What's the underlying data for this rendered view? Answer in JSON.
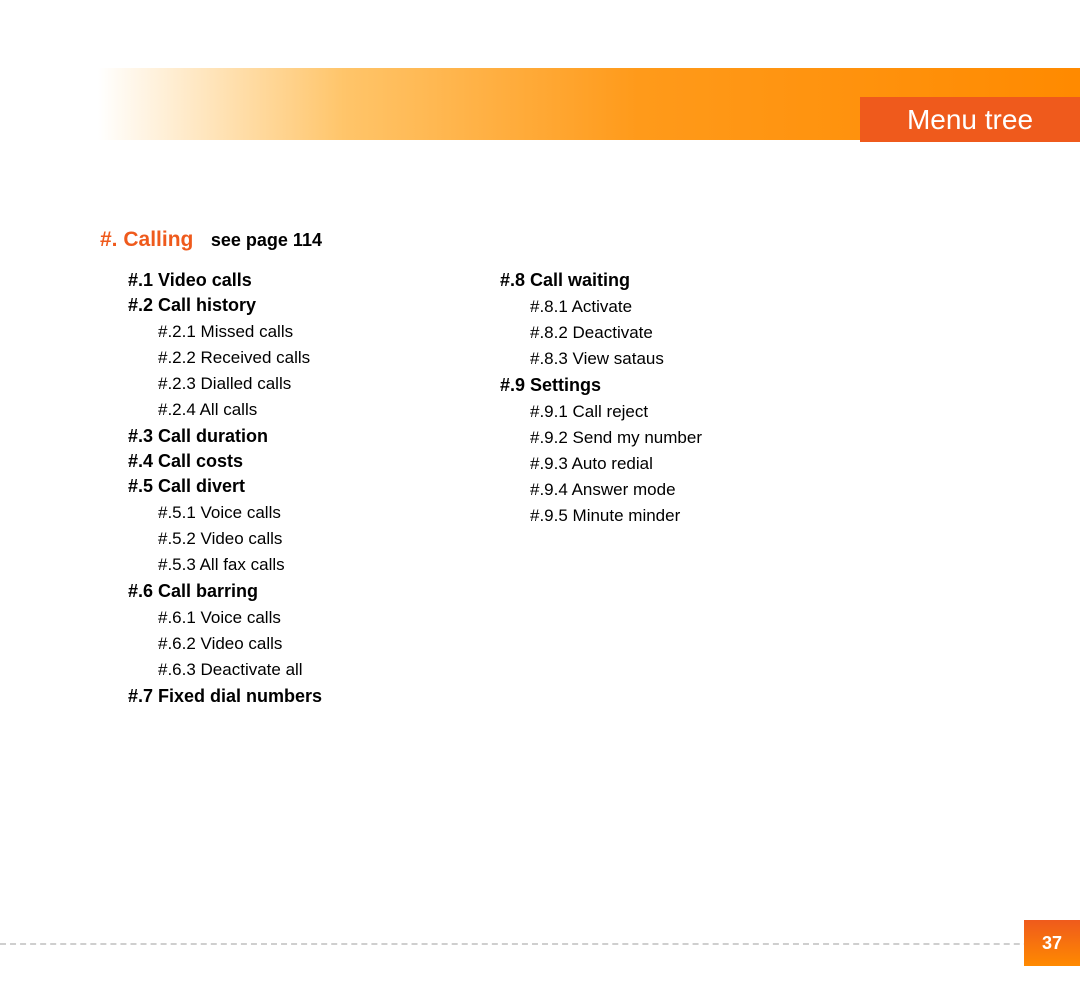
{
  "header": {
    "tab": "Menu tree"
  },
  "section": {
    "num": "#.",
    "name": "Calling",
    "ref": "see page 114"
  },
  "col1": {
    "i1": "#.1 Video calls",
    "i2": "#.2 Call history",
    "i2_1": "#.2.1 Missed calls",
    "i2_2": "#.2.2 Received calls",
    "i2_3": "#.2.3 Dialled calls",
    "i2_4": "#.2.4 All calls",
    "i3": "#.3 Call duration",
    "i4": "#.4 Call costs",
    "i5": "#.5 Call divert",
    "i5_1": "#.5.1 Voice calls",
    "i5_2": "#.5.2 Video calls",
    "i5_3": "#.5.3 All fax calls",
    "i6": "#.6 Call barring",
    "i6_1": "#.6.1 Voice calls",
    "i6_2": "#.6.2 Video calls",
    "i6_3": "#.6.3 Deactivate all",
    "i7": "#.7 Fixed dial numbers"
  },
  "col2": {
    "i8": "#.8 Call waiting",
    "i8_1": "#.8.1 Activate",
    "i8_2": "#.8.2 Deactivate",
    "i8_3": "#.8.3 View sataus",
    "i9": "#.9 Settings",
    "i9_1": "#.9.1 Call reject",
    "i9_2": "#.9.2 Send my number",
    "i9_3": "#.9.3 Auto redial",
    "i9_4": "#.9.4 Answer mode",
    "i9_5": "#.9.5 Minute minder"
  },
  "page": "37"
}
